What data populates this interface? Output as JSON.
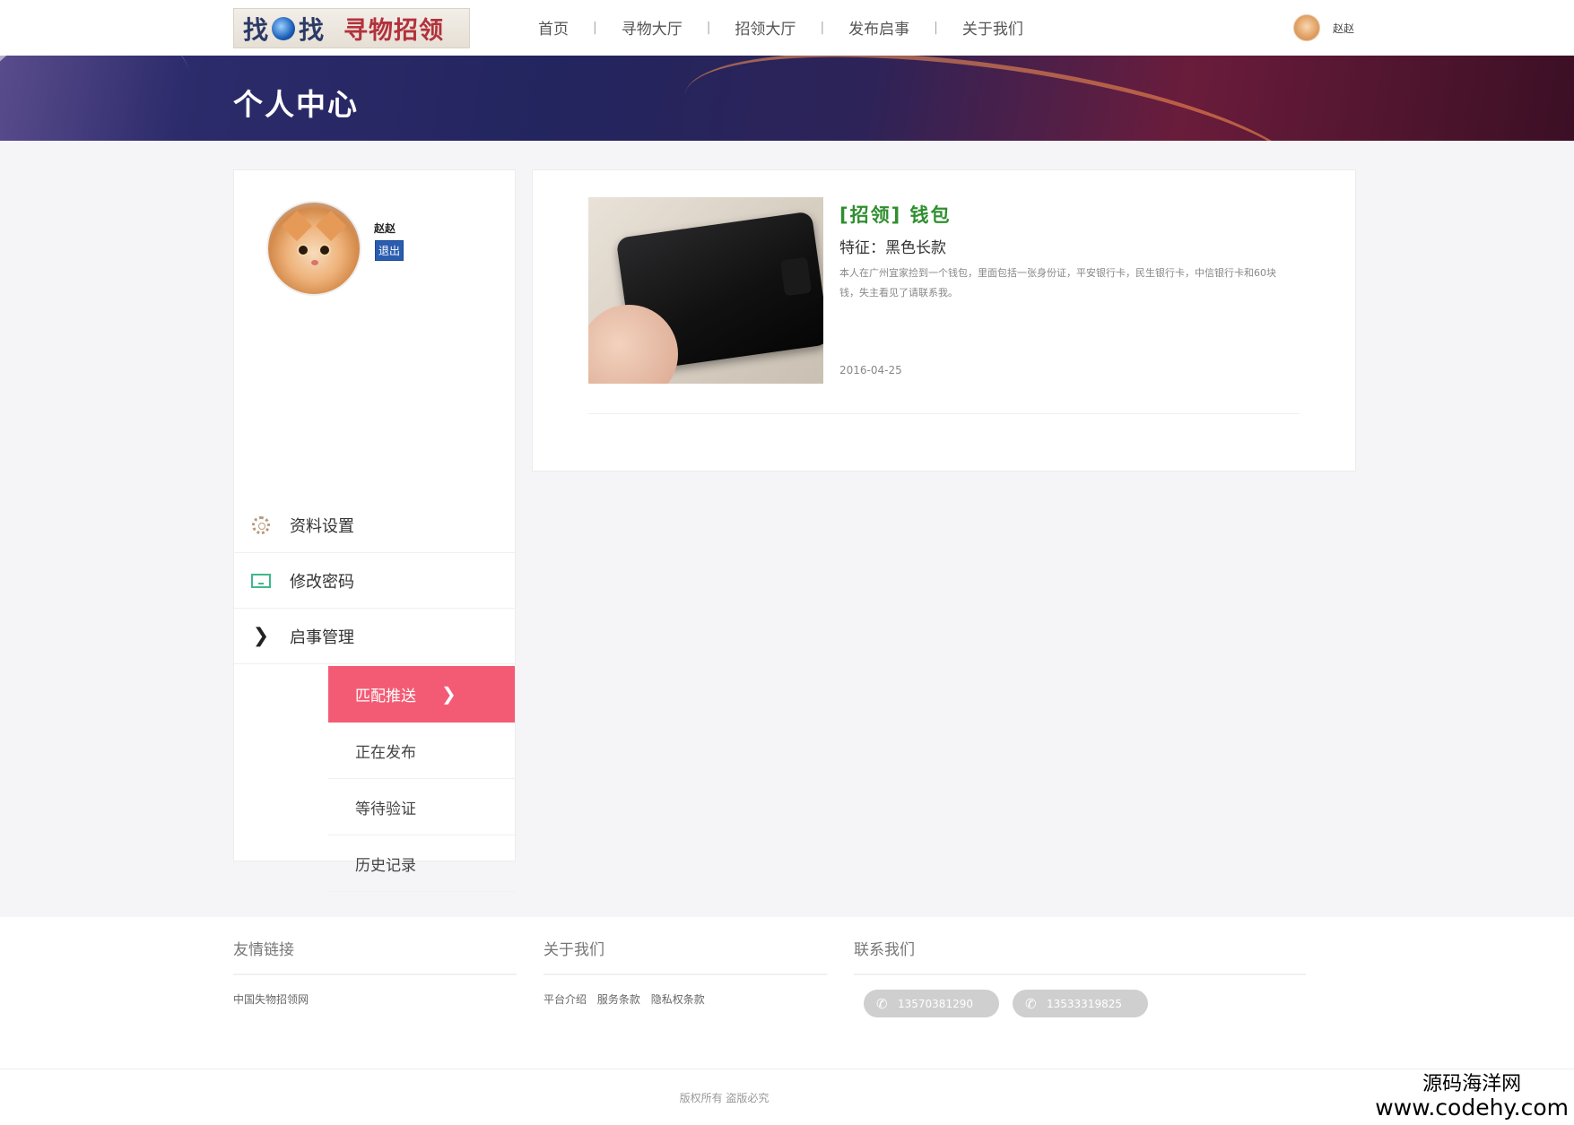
{
  "header": {
    "logo_left_a": "找",
    "logo_left_b": "找",
    "logo_right": "寻物招领",
    "nav": [
      "首页",
      "寻物大厅",
      "招领大厅",
      "发布启事",
      "关于我们"
    ],
    "nav_separator": "|",
    "username": "赵赵"
  },
  "banner": {
    "title": "个人中心"
  },
  "sidebar": {
    "username": "赵赵",
    "logout_label": "退出",
    "menu": [
      "资料设置",
      "修改密码",
      "启事管理"
    ],
    "submenu": [
      "匹配推送",
      "正在发布",
      "等待验证",
      "历史记录"
    ],
    "active_submenu": "匹配推送",
    "chevron": "❯"
  },
  "item": {
    "title": "[招领] 钱包",
    "feature": "特征：黑色长款",
    "description": "本人在广州宜家捡到一个钱包，里面包括一张身份证，平安银行卡，民生银行卡，中信银行卡和60块钱，失主看见了请联系我。",
    "date": "2016-04-25"
  },
  "footer": {
    "friend_links_title": "友情链接",
    "friend_links": [
      "中国失物招领网"
    ],
    "about_title": "关于我们",
    "about_links": [
      "平台介绍",
      "服务条款",
      "隐私权条款"
    ],
    "contact_title": "联系我们",
    "phones": [
      "13570381290",
      "13533319825"
    ],
    "copyright": "版权所有 盗版必究"
  },
  "watermark": {
    "line1": "源码海洋网",
    "line2": "www.codehy.com"
  },
  "colors": {
    "accent_pink": "#f35b74",
    "title_green": "#2f8f2f",
    "logout_blue": "#2a5db0"
  },
  "icons": [
    "gear-icon",
    "board-icon",
    "chevron-right-icon",
    "phone-icon"
  ]
}
